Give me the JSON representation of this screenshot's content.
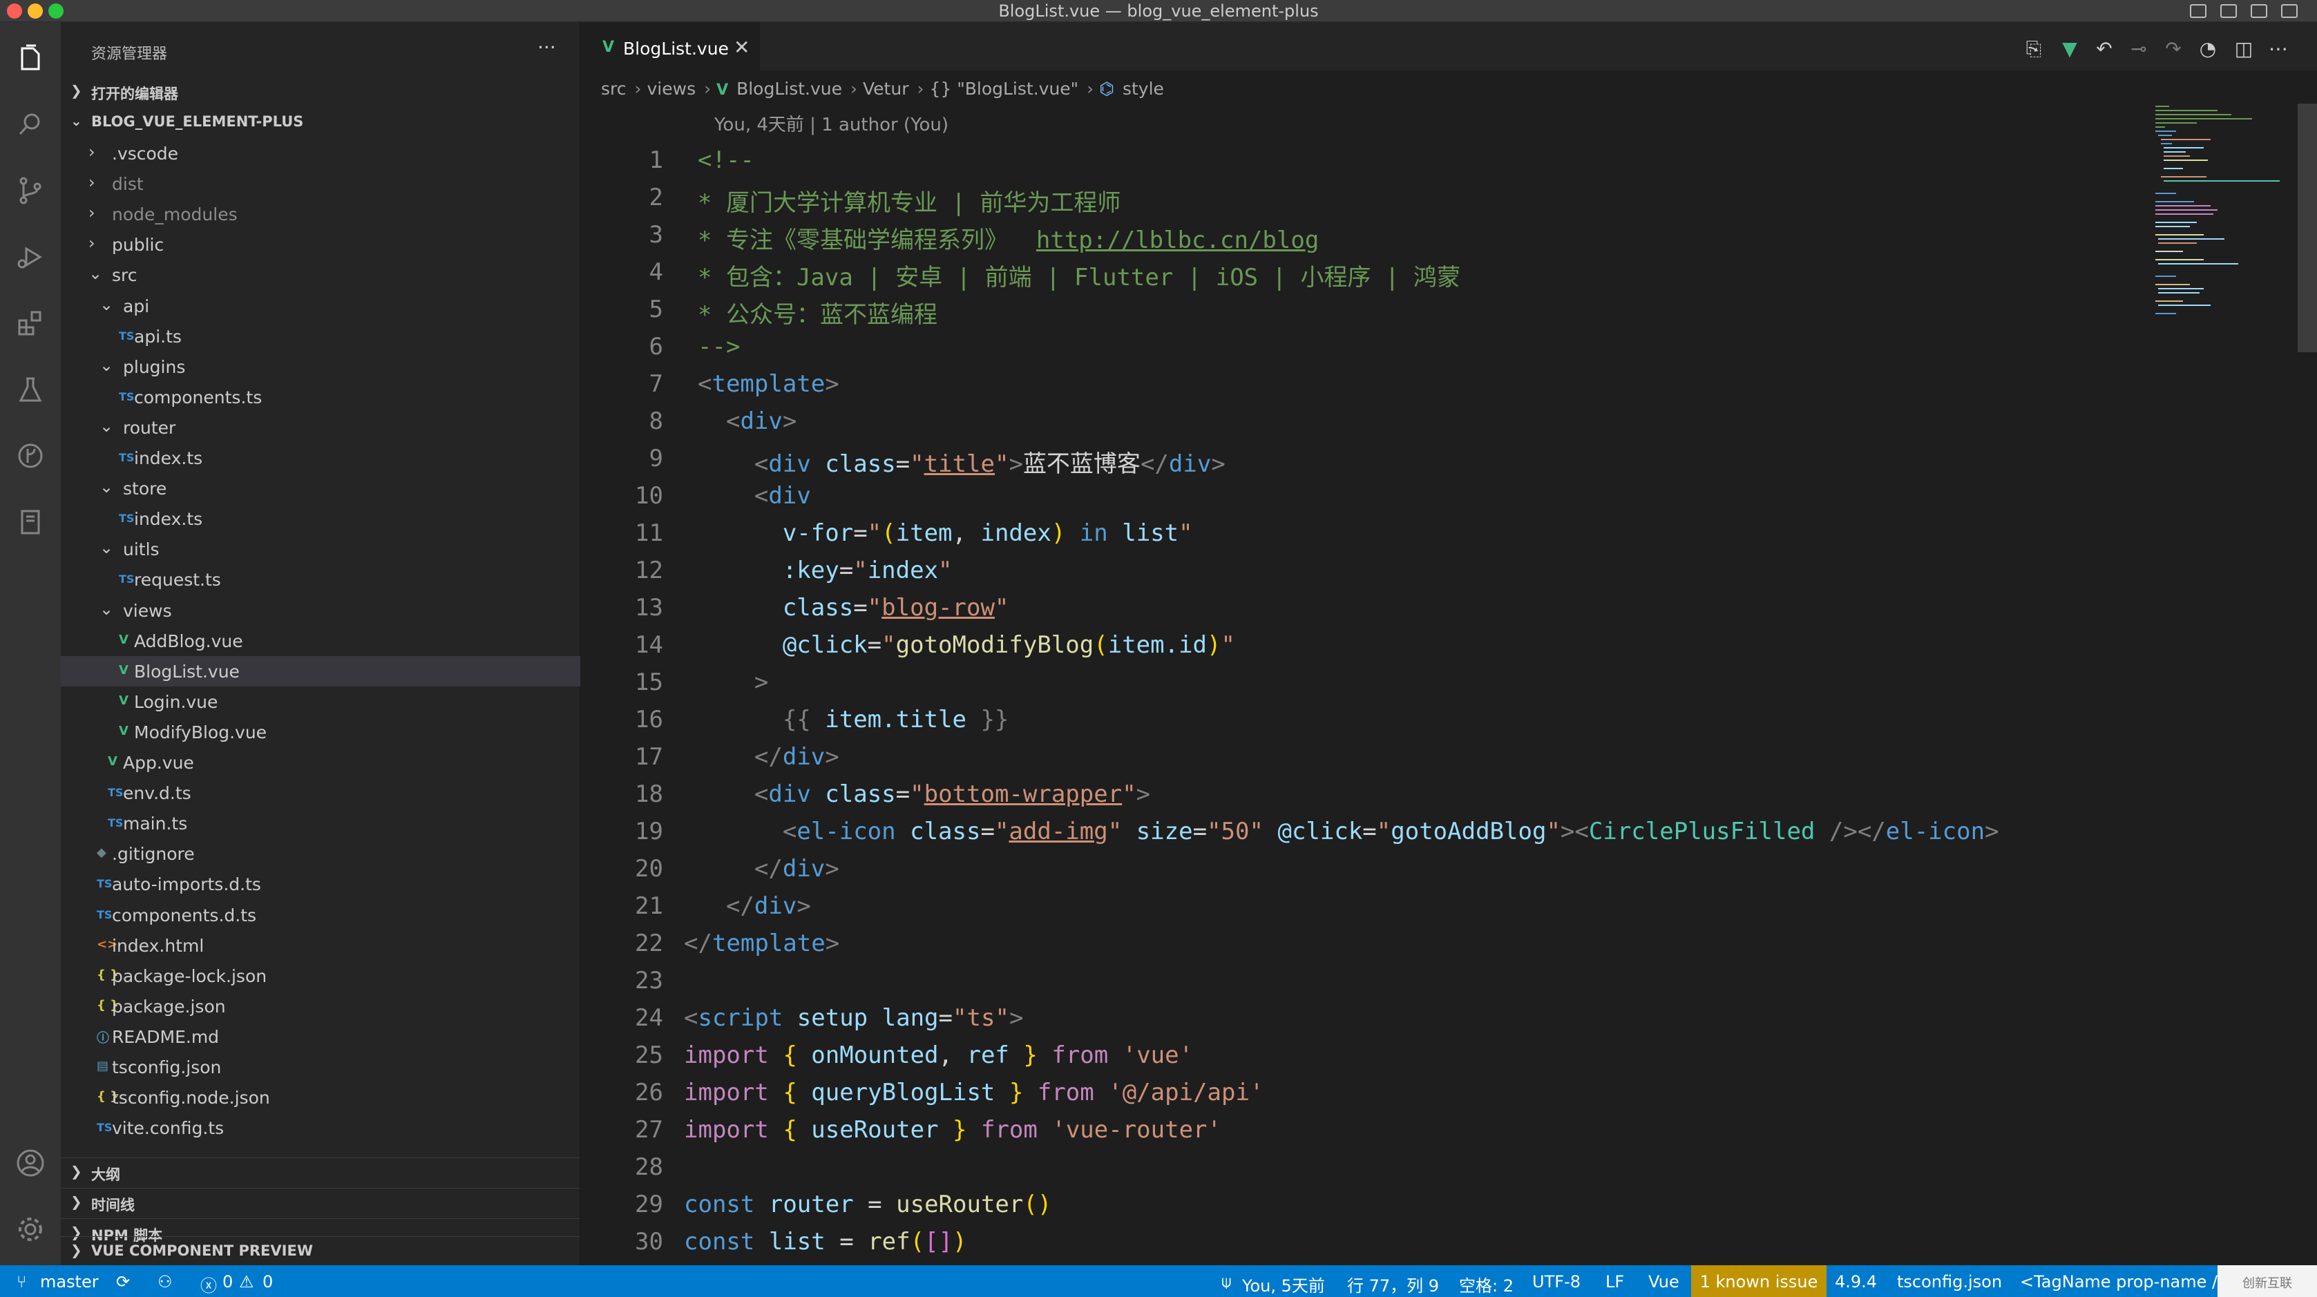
{
  "window": {
    "title": "BlogList.vue — blog_vue_element-plus"
  },
  "sidebar": {
    "title": "资源管理器",
    "more": "···",
    "open_editors": "打开的编辑器",
    "project": "BLOG_VUE_ELEMENT-PLUS",
    "tree": [
      {
        "name": ".vscode",
        "type": "folder",
        "expanded": false
      },
      {
        "name": "dist",
        "type": "folder",
        "expanded": false
      },
      {
        "name": "node_modules",
        "type": "folder",
        "expanded": false
      },
      {
        "name": "public",
        "type": "folder",
        "expanded": false
      },
      {
        "name": "src",
        "type": "folder",
        "expanded": true
      },
      {
        "name": "api",
        "type": "folder",
        "expanded": true
      },
      {
        "name": "api.ts",
        "type": "ts"
      },
      {
        "name": "plugins",
        "type": "folder",
        "expanded": true
      },
      {
        "name": "components.ts",
        "type": "ts"
      },
      {
        "name": "router",
        "type": "folder",
        "expanded": true
      },
      {
        "name": "index.ts",
        "type": "ts"
      },
      {
        "name": "store",
        "type": "folder",
        "expanded": true
      },
      {
        "name": "index.ts",
        "type": "ts"
      },
      {
        "name": "uitls",
        "type": "folder",
        "expanded": true
      },
      {
        "name": "request.ts",
        "type": "ts"
      },
      {
        "name": "views",
        "type": "folder",
        "expanded": true
      },
      {
        "name": "AddBlog.vue",
        "type": "vue"
      },
      {
        "name": "BlogList.vue",
        "type": "vue",
        "selected": true
      },
      {
        "name": "Login.vue",
        "type": "vue"
      },
      {
        "name": "ModifyBlog.vue",
        "type": "vue"
      },
      {
        "name": "App.vue",
        "type": "vue"
      },
      {
        "name": "env.d.ts",
        "type": "ts"
      },
      {
        "name": "main.ts",
        "type": "ts"
      },
      {
        "name": ".gitignore",
        "type": "git"
      },
      {
        "name": "auto-imports.d.ts",
        "type": "ts"
      },
      {
        "name": "components.d.ts",
        "type": "ts"
      },
      {
        "name": "index.html",
        "type": "html"
      },
      {
        "name": "package-lock.json",
        "type": "json"
      },
      {
        "name": "package.json",
        "type": "json"
      },
      {
        "name": "README.md",
        "type": "info"
      },
      {
        "name": "tsconfig.json",
        "type": "tsconfig"
      },
      {
        "name": "tsconfig.node.json",
        "type": "json"
      },
      {
        "name": "vite.config.ts",
        "type": "ts"
      }
    ],
    "sections": {
      "outline": "大纲",
      "timeline": "时间线",
      "npm": "NPM 脚本",
      "vue_preview": "VUE COMPONENT PREVIEW"
    }
  },
  "editor": {
    "tab_label": "BlogList.vue",
    "tab_close": "✕",
    "breadcrumb": {
      "src": "src",
      "views": "views",
      "file": "BlogList.vue",
      "vetur": "Vetur",
      "component": "{} \"BlogList.vue\"",
      "style": "style"
    },
    "blame": "You, 4天前 | 1 author (You)",
    "line_numbers": [
      "1",
      "2",
      "3",
      "4",
      "5",
      "6",
      "7",
      "8",
      "9",
      "10",
      "11",
      "12",
      "13",
      "14",
      "15",
      "16",
      "17",
      "18",
      "19",
      "20",
      "21",
      "22",
      "23",
      "24",
      "25",
      "26",
      "27",
      "28",
      "29",
      "30"
    ],
    "code": {
      "l1": "<!--",
      "l2": "* 厦门大学计算机专业 | 前华为工程师",
      "l3a": "* 专注《零基础学编程系列》  ",
      "l3b": "http://lblbc.cn/blog",
      "l4": "* 包含：Java | 安卓 | 前端 | Flutter | iOS | 小程序 | 鸿蒙",
      "l5": "* 公众号：蓝不蓝编程",
      "l6": "-->",
      "template": "template",
      "div": "div",
      "class": "class",
      "title_cls": "title",
      "title_text": "蓝不蓝博客",
      "vfor": "v-for",
      "vfor_item": "item",
      "vfor_index": "index",
      "vfor_in": "in",
      "vfor_list": "list",
      "key_attr": ":key",
      "key_val": "index",
      "blog_row": "blog-row",
      "click_attr": "@click",
      "modify_fn": "gotoModifyBlog",
      "item_id": "item.id",
      "interp_open": "{{",
      "interp_body": "item.title",
      "interp_close": "}}",
      "bottom_wrapper": "bottom-wrapper",
      "el_icon": "el-icon",
      "add_img": "add-img",
      "size_attr": "size",
      "size_val": "50",
      "add_fn": "gotoAddBlog",
      "circle_plus": "CirclePlusFilled",
      "script": "script",
      "setup": "setup",
      "lang": "lang",
      "lang_val": "ts",
      "import": "import",
      "from": "from",
      "onMounted": "onMounted",
      "ref": "ref",
      "vue_mod": "'vue'",
      "queryBlogList": "queryBlogList",
      "api_mod": "'@/api/api'",
      "useRouter": "useRouter",
      "router_mod": "'vue-router'",
      "const": "const",
      "router": "router",
      "list": "list"
    }
  },
  "statusbar": {
    "branch": "master",
    "errors": "0",
    "warnings": "0",
    "blame": "You, 5天前",
    "position": "行 77，列 9",
    "spaces": "空格: 2",
    "encoding": "UTF-8",
    "eol": "LF",
    "language": "Vue",
    "issue": "1 known issue",
    "version": "4.9.4",
    "tsconfig": "tsconfig.json",
    "tagname": "<TagName prop-name />",
    "watermark": "创新互联"
  },
  "colors": {
    "accent": "#007acc",
    "vue_green": "#41b883",
    "ts_blue": "#3c8fd6",
    "issue_bg": "#c09400"
  },
  "icons": {
    "activity": [
      "files-icon",
      "search-icon",
      "source-control-icon",
      "run-debug-icon",
      "extensions-icon",
      "testing-icon",
      "git-graph-icon",
      "notebook-icon",
      "account-icon",
      "settings-gear-icon"
    ]
  }
}
